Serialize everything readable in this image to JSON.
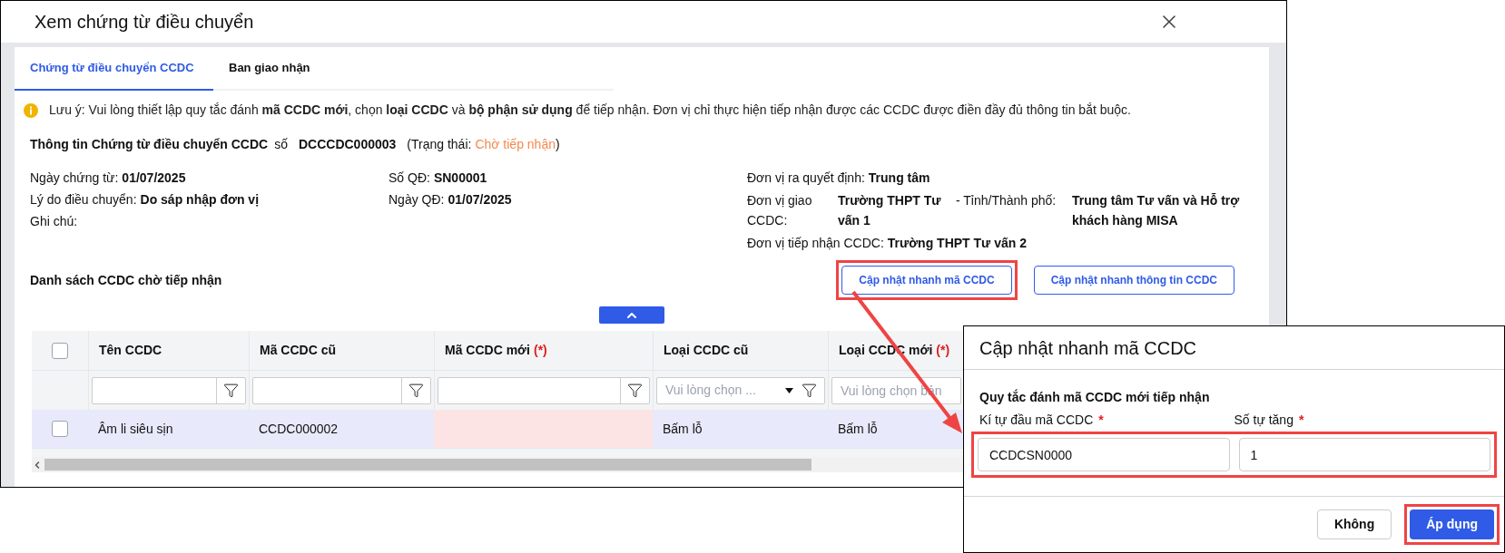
{
  "dialog": {
    "title": "Xem chứng từ điều chuyển"
  },
  "tabs": [
    {
      "label": "Chứng từ điều chuyển CCDC",
      "selected": true
    },
    {
      "label": "Ban giao nhận",
      "selected": false
    }
  ],
  "notice": "Lưu ý: Vui lòng thiết lập quy tắc đánh **mã CCDC mới**, chọn **loại CCDC** và **bộ phận sử dụng** để tiếp nhận. Đơn vị chỉ thực hiện tiếp nhận được các CCDC được điền đầy đủ thông tin bắt buộc.",
  "voucher": {
    "heading": "Thông tin Chứng từ điều chuyển CCDC",
    "number_label": "số",
    "number": "DCCCDC000003",
    "status_label": "(Trạng thái:",
    "status": "Chờ tiếp nhận",
    "status_close": ")"
  },
  "details": [
    [
      {
        "label": "Ngày chứng từ:",
        "value": "01/07/2025"
      },
      {
        "label": "Lý do điều chuyển:",
        "value": "Do sáp nhập đơn vị"
      },
      {
        "label": "Ghi chú:"
      }
    ],
    [
      {
        "label": "Số QĐ:",
        "value": "SN00001"
      },
      {
        "label": "Ngày QĐ:",
        "value": "01/07/2025"
      }
    ]
  ],
  "units": {
    "decider": {
      "label": "Đơn vị ra quyết định:",
      "value": "Trung tâm"
    },
    "sender": {
      "label": "Đơn vị giao CCDC:",
      "value": "Trường THPT Tư vấn 1",
      "province_label": "- Tỉnh/Thành phố:",
      "province": "Trung tâm Tư vấn và Hỗ trợ khách hàng MISA"
    },
    "receiver": {
      "label": "Đơn vị tiếp nhận CCDC:",
      "value": "Trường THPT Tư vấn 2"
    }
  },
  "list_title": "Danh sách CCDC chờ tiếp nhận",
  "actions": [
    {
      "label": "Cập nhật nhanh mã CCDC",
      "annotated": true
    },
    {
      "label": "Cập nhật nhanh thông tin CCDC",
      "annotated": false
    }
  ],
  "table": {
    "header_checked": false,
    "columns": [
      {
        "label": "Tên CCDC"
      },
      {
        "label": "Mã CCDC cũ"
      },
      {
        "label": "Mã CCDC mới",
        "required_mark": "(*)"
      },
      {
        "label": "Loại CCDC cũ"
      },
      {
        "label": "Loại CCDC mới",
        "required_mark": "(*)"
      }
    ],
    "filters": [
      {
        "kind": "text"
      },
      {
        "kind": "text"
      },
      {
        "kind": "text"
      },
      {
        "kind": "select",
        "placeholder": "Vui lòng chọn ..."
      },
      {
        "kind": "plain",
        "placeholder": "Vui lòng chọn bản"
      }
    ],
    "rows": [
      {
        "checked": false,
        "cells": [
          {
            "text": "Âm li siêu sịn",
            "invalid": false
          },
          {
            "text": "CCDC000002",
            "invalid": false
          },
          {
            "invalid": true
          },
          {
            "text": "Bấm lỗ",
            "invalid": false
          },
          {
            "text": "Bấm lỗ",
            "invalid": false
          }
        ]
      }
    ]
  },
  "popup": {
    "title": "Cập nhật nhanh mã CCDC",
    "section": "Quy tắc đánh mã CCDC mới tiếp nhận",
    "fields": [
      {
        "label": "Kí tự đầu mã CCDC",
        "required_mark": "*",
        "value": "CCDCSN0000"
      },
      {
        "label": "Số tự tăng",
        "required_mark": "*",
        "value": "1"
      }
    ],
    "fields_annotated": true,
    "buttons": [
      {
        "label": "Không",
        "primary": false,
        "annotated": false
      },
      {
        "label": "Áp dụng",
        "primary": true,
        "annotated": true
      }
    ]
  }
}
